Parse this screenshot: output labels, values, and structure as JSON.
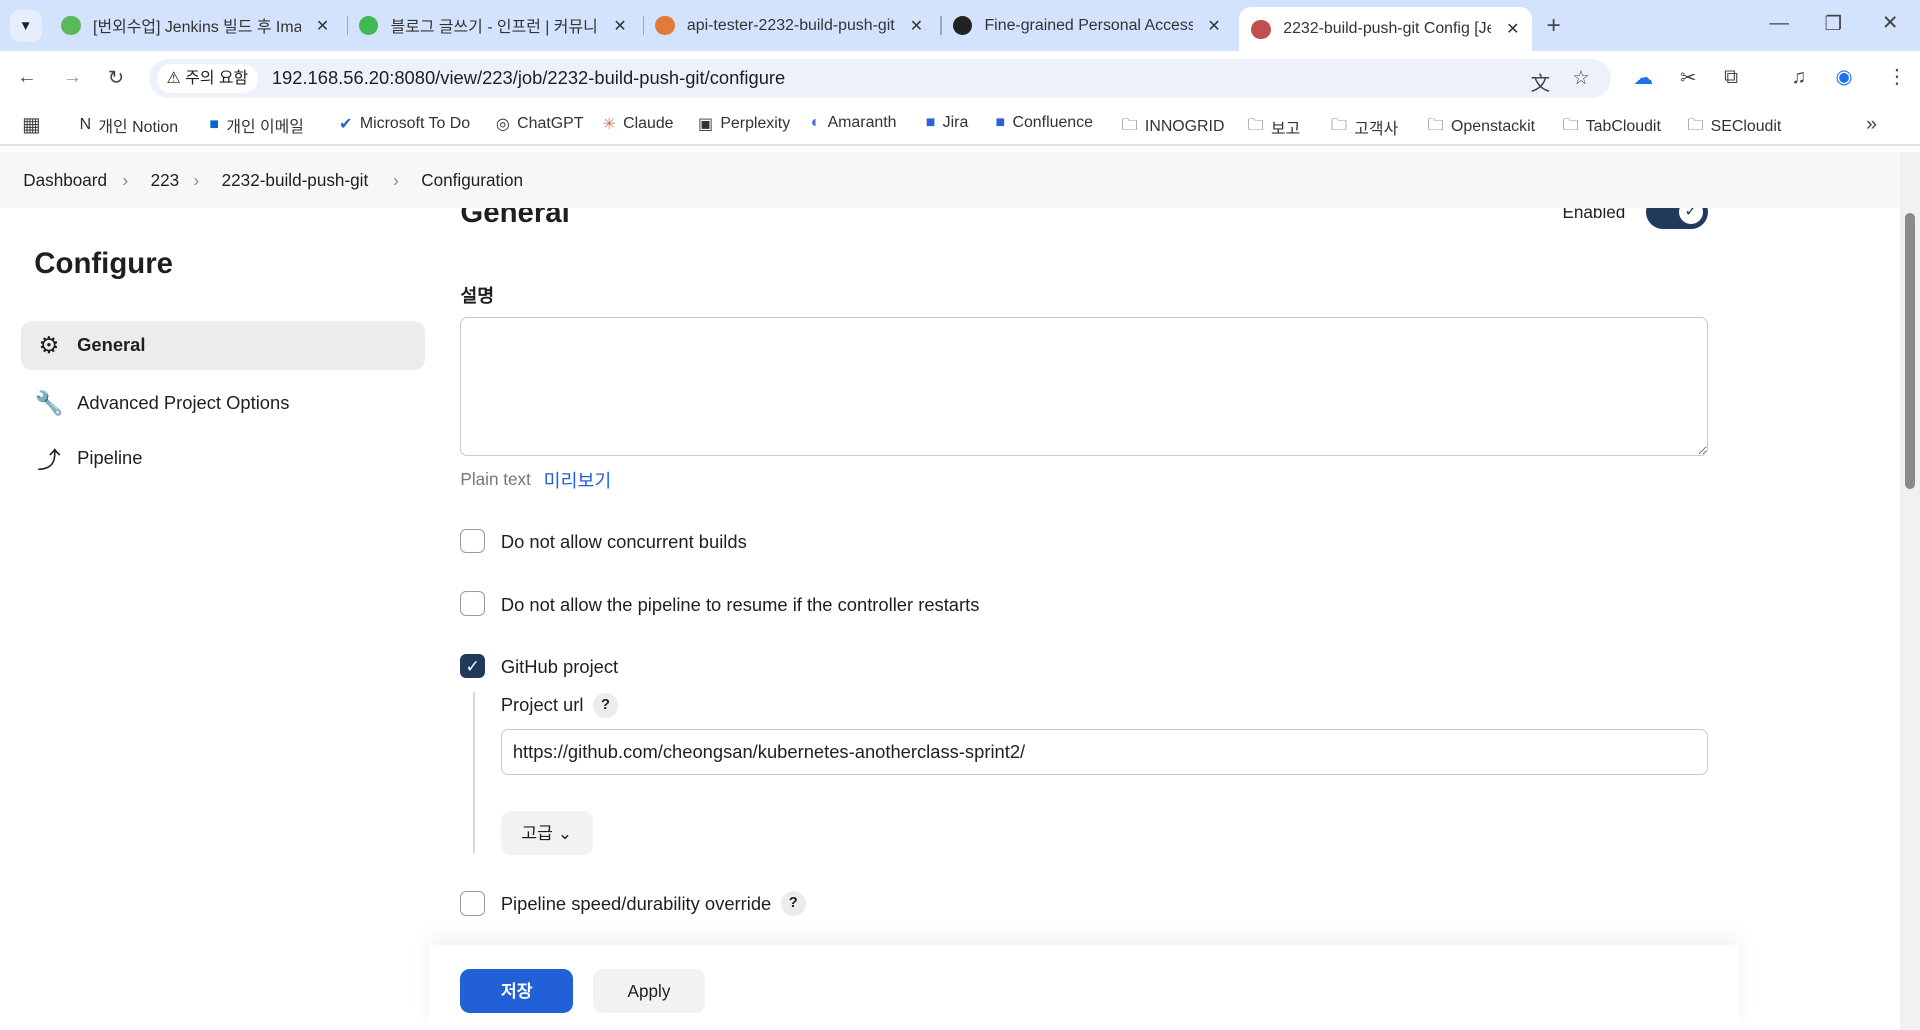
{
  "browser": {
    "tabs": [
      {
        "title": "[번외수업] Jenkins 빌드 후 Ima",
        "color": "#5cb85c"
      },
      {
        "title": "블로그 글쓰기 - 인프런 | 커뮤니",
        "color": "#3fb950"
      },
      {
        "title": "api-tester-2232-build-push-git",
        "color": "#e07b39"
      },
      {
        "title": "Fine-grained Personal Access T",
        "color": "#222222"
      },
      {
        "title": "2232-build-push-git Config [Je",
        "color": "#c0504d"
      }
    ],
    "security_chip": "주의 요함",
    "url": "192.168.56.20:8080/view/223/job/2232-build-push-git/configure",
    "bookmarks": [
      "개인 Notion",
      "개인 이메일",
      "Microsoft To Do",
      "ChatGPT",
      "Claude",
      "Perplexity",
      "Amaranth",
      "Jira",
      "Confluence",
      "INNOGRID",
      "보고",
      "고객사",
      "Openstackit",
      "TabCloudit",
      "SECloudit"
    ]
  },
  "breadcrumb": [
    "Dashboard",
    "223",
    "2232-build-push-git",
    "Configuration"
  ],
  "sidebar": {
    "title": "Configure",
    "items": [
      {
        "label": "General",
        "icon": "gear-icon"
      },
      {
        "label": "Advanced Project Options",
        "icon": "wrench-icon"
      },
      {
        "label": "Pipeline",
        "icon": "pipeline-icon"
      }
    ]
  },
  "main": {
    "section_title": "General",
    "enabled_label": "Enabled",
    "enabled": true,
    "description_label": "설명",
    "description_value": "",
    "plain_text": "Plain text",
    "preview_link": "미리보기",
    "options": [
      {
        "label": "Do not allow concurrent builds",
        "checked": false
      },
      {
        "label": "Do not allow the pipeline to resume if the controller restarts",
        "checked": false
      },
      {
        "label": "GitHub project",
        "checked": true
      },
      {
        "label": "Pipeline speed/durability override",
        "checked": false
      }
    ],
    "project_url_label": "Project url",
    "project_url_value": "https://github.com/cheongsan/kubernetes-anotherclass-sprint2/",
    "advanced_button": "고급",
    "help": "?"
  },
  "footer": {
    "save": "저장",
    "apply": "Apply"
  },
  "colors": {
    "accent": "#2160d6",
    "toggle": "#1f3a5a"
  }
}
